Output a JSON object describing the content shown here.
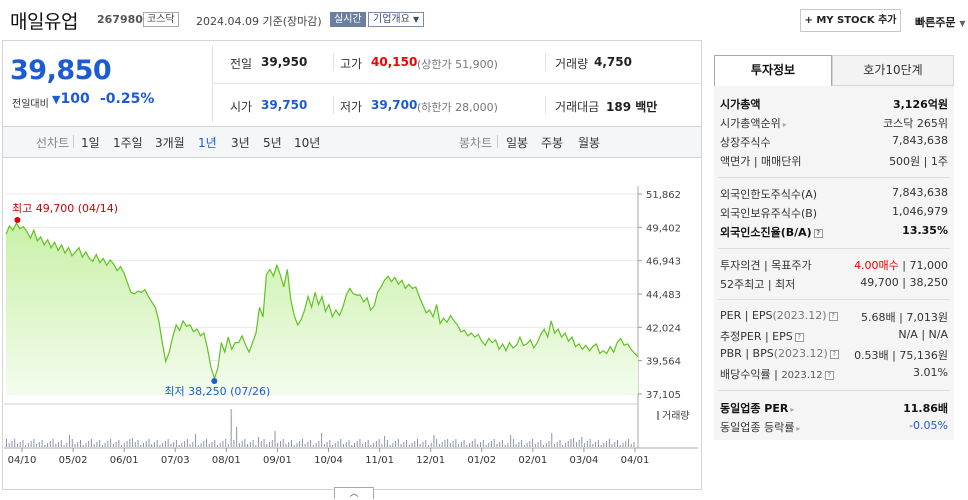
{
  "header": {
    "title": "매일유업",
    "code": "267980",
    "market": "코스닥",
    "date": "2024.04.09 기준(장마감)",
    "live": "실시간",
    "company_info": "기업개요",
    "mystock_button": "+ MY STOCK 추가",
    "quick_order": "빠른주문"
  },
  "price": {
    "current": "39,850",
    "change_label": "전일대비",
    "change_value": "100",
    "change_pct": "-0.25%"
  },
  "quote": {
    "prev_label": "전일",
    "prev_value": "39,950",
    "high_label": "고가",
    "high_value": "40,150",
    "upper_limit": "(상한가 51,900)",
    "volume_label": "거래량",
    "volume_value": "4,750",
    "open_label": "시가",
    "open_value": "39,750",
    "low_label": "저가",
    "low_value": "39,700",
    "lower_limit": "(하한가 28,000)",
    "amount_label": "거래대금",
    "amount_value": "189 백만"
  },
  "tabs": {
    "line_label": "선차트",
    "line_items": [
      "1일",
      "1주일",
      "3개월",
      "1년",
      "3년",
      "5년",
      "10년"
    ],
    "selected": "1년",
    "candle_label": "봉차트",
    "candle_items": [
      "일봉",
      "주봉",
      "월봉"
    ]
  },
  "chart_data": {
    "type": "area",
    "title": "",
    "xlabel": "",
    "ylabel": "",
    "y_ticks": [
      "51,862",
      "49,402",
      "46,943",
      "44,483",
      "42,024",
      "39,564",
      "37,105"
    ],
    "ylim": [
      37105,
      51862
    ],
    "x_ticks": [
      "04/10",
      "05/02",
      "06/01",
      "07/03",
      "08/01",
      "09/01",
      "10/04",
      "11/01",
      "12/01",
      "01/02",
      "02/01",
      "03/04",
      "04/01"
    ],
    "max_annotation": "최고 49,700 (04/14)",
    "min_annotation": "최저 38,250 (07/26)",
    "volume_label": "거래량",
    "grid": true,
    "series": [
      {
        "values": [
          48900,
          49500,
          49200,
          49700,
          49300,
          49450,
          49100,
          48600,
          49200,
          48400,
          48700,
          48100,
          48500,
          47900,
          48300,
          47700,
          48100,
          47500,
          47900,
          47300,
          47600,
          47900,
          47200,
          47600,
          47100,
          46900,
          47400,
          46800,
          47100,
          46600,
          47000,
          46700,
          46200,
          46500,
          46000,
          45300,
          44600,
          44500,
          44700,
          44600,
          44800,
          44300,
          43900,
          43500,
          42500,
          40900,
          39500,
          40200,
          41300,
          42200,
          41800,
          42500,
          42100,
          42200,
          41700,
          41900,
          41400,
          41600,
          40500,
          39100,
          38250,
          39000,
          40900,
          40200,
          41300,
          40400,
          40900,
          40900,
          41400,
          40700,
          40200,
          40900,
          41600,
          43500,
          42800,
          45900,
          46300,
          45800,
          46600,
          45900,
          45000,
          46300,
          44100,
          42900,
          42200,
          42600,
          43300,
          44300,
          43500,
          44600,
          43700,
          44300,
          43200,
          43700,
          42800,
          43300,
          42900,
          43500,
          44400,
          44900,
          44500,
          44400,
          44400,
          43900,
          44200,
          43300,
          43600,
          44600,
          45000,
          45500,
          45800,
          45400,
          45700,
          45200,
          45500,
          44900,
          45200,
          44900,
          45000,
          44300,
          43700,
          43100,
          43300,
          42800,
          43700,
          42300,
          42700,
          42400,
          42900,
          42500,
          42200,
          41700,
          41800,
          41400,
          41600,
          41300,
          41500,
          41000,
          40700,
          41200,
          40900,
          41100,
          40400,
          40800,
          40300,
          40900,
          40500,
          40700,
          41300,
          40700,
          40800,
          41100,
          40500,
          40900,
          41500,
          41900,
          41300,
          42500,
          41600,
          41900,
          41300,
          41600,
          41000,
          41300,
          40600,
          40800,
          40400,
          40700,
          40300,
          40600,
          40800,
          40100,
          40300,
          40100,
          40600,
          40200,
          40900,
          41200,
          40700,
          40800,
          40400,
          40100,
          39850
        ]
      }
    ]
  },
  "side": {
    "tab_active": "투자정보",
    "tab_inactive": "호가10단계",
    "rows1": [
      {
        "label": "시가총액",
        "value": "3,126억원"
      },
      {
        "label": "시가총액순위",
        "value": "코스닥 265위"
      },
      {
        "label": "상장주식수",
        "value": "7,843,638"
      },
      {
        "label": "액면가 | 매매단위",
        "value": "500원 | 1주"
      }
    ],
    "rows2": [
      {
        "label": "외국인한도주식수(A)",
        "value": "7,843,638"
      },
      {
        "label": "외국인보유주식수(B)",
        "value": "1,046,979"
      },
      {
        "label": "외국인소진율(B/A)",
        "value": "13.35%"
      }
    ],
    "rows3": [
      {
        "label": "투자의견 | 목표주가",
        "value_a": "4.00매수",
        "value_b": "71,000"
      },
      {
        "label": "52주최고 | 최저",
        "value_a": "49,700",
        "value_b": "38,250"
      }
    ],
    "rows4": [
      {
        "label_a": "PER",
        "label_b": "EPS",
        "year": "(2023.12)",
        "value_a": "5.68배",
        "value_b": "7,013원"
      },
      {
        "label_a": "추정PER",
        "label_b": "EPS",
        "year": "",
        "value_a": "N/A",
        "value_b": "N/A"
      },
      {
        "label_a": "PBR",
        "label_b": "BPS",
        "year": "(2023.12)",
        "value_a": "0.53배",
        "value_b": "75,136원"
      },
      {
        "label_a": "배당수익률",
        "label_b": "",
        "year": "2023.12",
        "value_a": "",
        "value_b": "3.01%"
      }
    ],
    "rows5": [
      {
        "label": "동일업종 PER",
        "value": "11.86배"
      },
      {
        "label": "동일업종 등락률",
        "value": "-0.05%"
      }
    ]
  }
}
